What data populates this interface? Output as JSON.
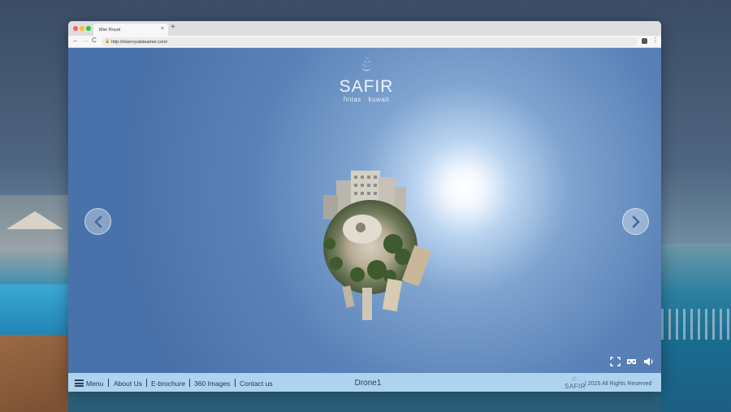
{
  "browser": {
    "tab_title": "Misr Royal",
    "tab_close": "×",
    "new_tab": "+",
    "url": "http://misrroyalsteamer.com/",
    "back": "←",
    "forward": "→",
    "reload": "C",
    "menu": "⋮"
  },
  "brand": {
    "name": "SAFIR",
    "subtitle": "fintas · kuwait"
  },
  "viewer": {
    "prev_icon": "chevron-left-icon",
    "next_icon": "chevron-right-icon",
    "controls": [
      "fullscreen-icon",
      "vr-headset-icon",
      "volume-icon"
    ]
  },
  "footer": {
    "menu": "Menu",
    "links": [
      "About Us",
      "E-brochure",
      "360 Images",
      "Contact us"
    ],
    "scene_name": "Drone1",
    "logo": "SAFIR",
    "copyright": "| 2025 All Rights Reserved"
  },
  "colors": {
    "sky": "#5b82b8",
    "footer_bg": "#aed3ee",
    "text_dark": "#1f3550"
  }
}
